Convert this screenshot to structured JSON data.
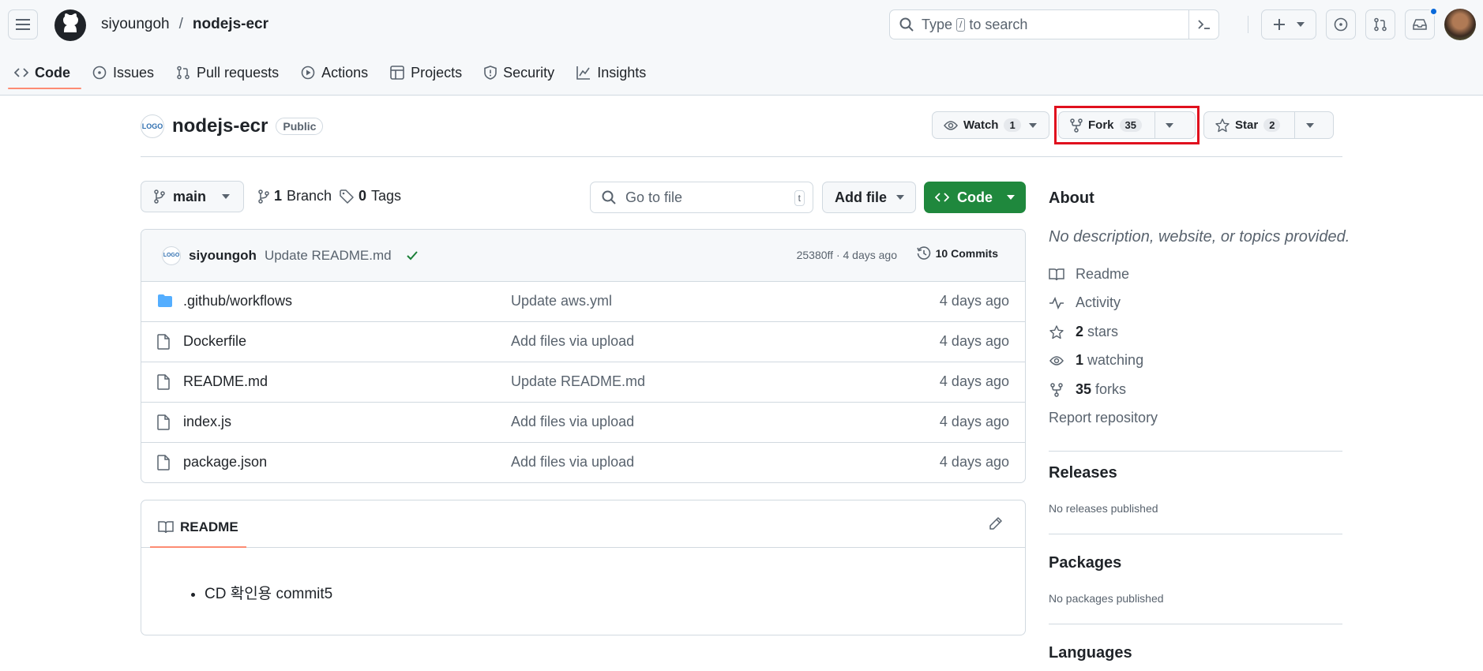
{
  "header": {
    "owner": "siyoungoh",
    "separator": "/",
    "repo": "nodejs-ecr",
    "search_prefix": "Type",
    "search_key": "/",
    "search_suffix": "to search"
  },
  "tabs": [
    "Code",
    "Issues",
    "Pull requests",
    "Actions",
    "Projects",
    "Security",
    "Insights"
  ],
  "repo": {
    "name": "nodejs-ecr",
    "visibility": "Public",
    "avatar_text": "LOGO",
    "watch_label": "Watch",
    "watch_count": "1",
    "fork_label": "Fork",
    "fork_count": "35",
    "star_label": "Star",
    "star_count": "2"
  },
  "toolbar": {
    "branch": "main",
    "branch_count": "1",
    "branch_label": "Branch",
    "tag_count": "0",
    "tag_label": "Tags",
    "go_to_file": "Go to file",
    "go_to_file_key": "t",
    "add_file": "Add file",
    "code": "Code"
  },
  "commit": {
    "author": "siyoungoh",
    "message": "Update README.md",
    "sha_date": "25380ff · 4 days ago",
    "commits": "10 Commits"
  },
  "files": [
    {
      "name": ".github/workflows",
      "type": "folder",
      "message": "Update aws.yml",
      "date": "4 days ago"
    },
    {
      "name": "Dockerfile",
      "type": "file",
      "message": "Add files via upload",
      "date": "4 days ago"
    },
    {
      "name": "README.md",
      "type": "file",
      "message": "Update README.md",
      "date": "4 days ago"
    },
    {
      "name": "index.js",
      "type": "file",
      "message": "Add files via upload",
      "date": "4 days ago"
    },
    {
      "name": "package.json",
      "type": "file",
      "message": "Add files via upload",
      "date": "4 days ago"
    }
  ],
  "readme": {
    "tab": "README",
    "item": "CD 확인용 commit5"
  },
  "about": {
    "title": "About",
    "description": "No description, website, or topics provided.",
    "readme": "Readme",
    "activity": "Activity",
    "stars_n": "2",
    "stars": "stars",
    "watching_n": "1",
    "watching": "watching",
    "forks_n": "35",
    "forks": "forks",
    "report": "Report repository"
  },
  "releases": {
    "title": "Releases",
    "text": "No releases published"
  },
  "packages": {
    "title": "Packages",
    "text": "No packages published"
  },
  "languages": {
    "title": "Languages"
  }
}
